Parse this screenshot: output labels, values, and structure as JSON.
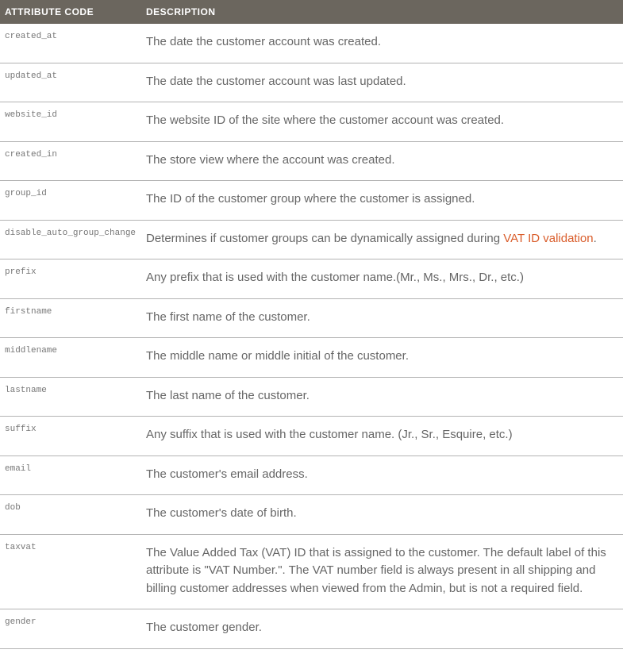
{
  "headers": {
    "code": "ATTRIBUTE CODE",
    "desc": "DESCRIPTION"
  },
  "rows": [
    {
      "code": "created_at",
      "desc": "The date the customer account was created."
    },
    {
      "code": "updated_at",
      "desc": "The date the customer account was last updated."
    },
    {
      "code": "website_id",
      "desc": "The website ID of the site where the customer account was created."
    },
    {
      "code": "created_in",
      "desc": "The store view where the account was created."
    },
    {
      "code": "group_id",
      "desc": "The ID of the customer group where the customer is assigned."
    },
    {
      "code": "disable_auto_group_change",
      "desc_pre": "Determines if customer groups can be dynamically assigned during ",
      "link_text": "VAT ID validation",
      "desc_post": "."
    },
    {
      "code": "prefix",
      "desc": "Any prefix that is used with the customer name.(Mr., Ms., Mrs., Dr., etc.)"
    },
    {
      "code": "firstname",
      "desc": "The first name of the customer."
    },
    {
      "code": "middlename",
      "desc": "The middle name or middle initial of the customer."
    },
    {
      "code": "lastname",
      "desc": "The last name of the customer."
    },
    {
      "code": "suffix",
      "desc": "Any suffix that is used with the customer name. (Jr., Sr., Esquire, etc.)"
    },
    {
      "code": "email",
      "desc": "The customer's email address."
    },
    {
      "code": "dob",
      "desc": "The customer's date of birth."
    },
    {
      "code": "taxvat",
      "desc": "The Value Added Tax (VAT) ID that is assigned to the customer. The default label of this attribute is \"VAT Number.\". The VAT number field is always present in all shipping and billing customer addresses when viewed from the Admin, but is not a required field."
    },
    {
      "code": "gender",
      "desc": "The customer gender."
    }
  ]
}
